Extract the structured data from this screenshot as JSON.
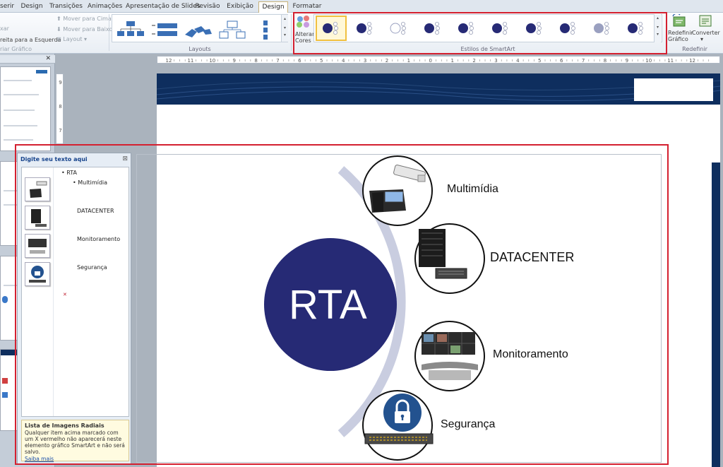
{
  "tabs": [
    "serir",
    "Design",
    "Transições",
    "Animações",
    "Apresentação de Slides",
    "Revisão",
    "Exibição",
    "Design",
    "Formatar"
  ],
  "ribbon": {
    "create_graphic": {
      "item_1": "xar",
      "item_2": "reita para a Esquerda",
      "item_3": "riar Gráfico",
      "move_up": "Mover para Cima",
      "move_down": "Mover para Baixo",
      "layout": "Layout"
    },
    "layouts_label": "Layouts",
    "change_colors": "Alterar Cores",
    "styles_label": "Estilos de SmartArt",
    "reset_graphic": "Redefinir Gráfico",
    "convert": "Converter",
    "reset_label": "Redefinir"
  },
  "ruler_ticks": [
    "12",
    "11",
    "10",
    "9",
    "8",
    "7",
    "6",
    "5",
    "4",
    "3",
    "2",
    "1",
    "0",
    "1",
    "2",
    "3",
    "4",
    "5",
    "6",
    "7",
    "8",
    "9",
    "10",
    "11",
    "12"
  ],
  "vruler_ticks": [
    "9",
    "8",
    "7"
  ],
  "text_pane": {
    "title": "Digite seu texto aqui",
    "bullets": {
      "root": "RTA",
      "item_1": "Multimídia",
      "item_2": "DATACENTER",
      "item_3": "Monitoramento",
      "item_4": "Segurança"
    },
    "info_title": "Lista de Imagens Radiais",
    "info_desc": "Qualquer item acima marcado com um X vermelho não aparecerá neste elemento gráfico SmartArt e não será salvo.",
    "info_link": "Saiba mais"
  },
  "smartart": {
    "center": "RTA",
    "items": [
      "Multimídia",
      "DATACENTER",
      "Monitoramento",
      "Segurança"
    ]
  },
  "colors": {
    "navy": "#262a75",
    "banner": "#0e2e5e",
    "highlight": "#d42030",
    "arc": "#c9cde0"
  },
  "icons": [
    "phone-camera-icon",
    "datacenter-server-icon",
    "monitoring-room-icon",
    "lock-firewall-icon"
  ]
}
